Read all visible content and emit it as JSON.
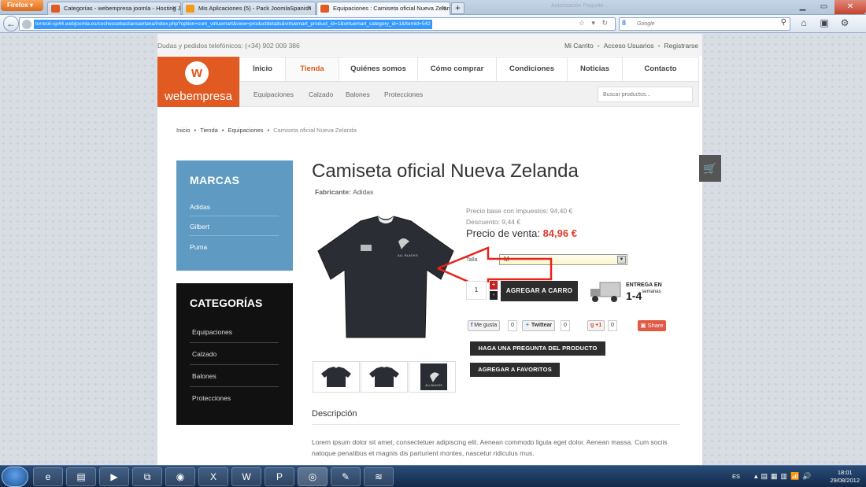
{
  "browser": {
    "menu_button": "Firefox",
    "tabs": [
      {
        "label": "Categorías - webempresa joomla - Hosting Jo...",
        "active": false,
        "icon_color": "#e05a22"
      },
      {
        "label": "Mis Aplicaciones (5) - Pack JoomlaSpanish",
        "active": false,
        "icon_color": "#f29b1a"
      },
      {
        "label": "Equipaciones : Camiseta oficial Nueva Zelanda",
        "active": true,
        "icon_color": "#e05a22"
      }
    ],
    "new_tab": "+",
    "blurred_tab": "Autorización Paquete...",
    "url": "torreoli-cp44.webjoomla.es/cochessebastiansantana/index.php?option=com_virtuemart&view=productdetails&virtuemart_product_id=1&virtuemart_category_id=1&Itemid=542",
    "search_placeholder": "Google",
    "search_engine": "8"
  },
  "site": {
    "phone": "Dudas y pedidos telefónicos: (+34) 902 009 386",
    "top_links": [
      "Mi Carrito",
      "Acceso Usuarios",
      "Registrarse"
    ],
    "logo_text": "webempresa",
    "logo_mark": "w",
    "nav": [
      {
        "label": "Inicio",
        "active": false
      },
      {
        "label": "Tienda",
        "active": true
      },
      {
        "label": "Quiénes somos",
        "active": false
      },
      {
        "label": "Cómo comprar",
        "active": false
      },
      {
        "label": "Condiciones",
        "active": false
      },
      {
        "label": "Noticias",
        "active": false
      },
      {
        "label": "Contacto",
        "active": false
      }
    ],
    "subnav": [
      "Equipaciones",
      "Calzado",
      "Balones",
      "Protecciones"
    ],
    "product_search_placeholder": "Buscar productos...",
    "breadcrumbs": [
      "Inicio",
      "Tienda",
      "Equipaciones",
      "Camiseta oficial Nueva Zelanda"
    ],
    "brands_title": "MARCAS",
    "brands": [
      "Adidas",
      "Gilbert",
      "Puma"
    ],
    "categories_title": "CATEGORÍAS",
    "categories": [
      "Equipaciones",
      "Calzado",
      "Balones",
      "Protecciones"
    ],
    "accent_color": "#e05a22",
    "brands_bg": "#5e9ac2"
  },
  "product": {
    "title": "Camiseta oficial Nueva Zelanda",
    "maker_label": "Fabricante:",
    "maker": "Adidas",
    "price_base": "Precio base con impuestos: 94,40 €",
    "discount": "Descuento: 9,44 €",
    "sale_label": "Precio de venta:",
    "sale_price": "84,96 €",
    "size_label": "Talla",
    "size_value": "M",
    "quantity": "1",
    "qty_plus": "+",
    "qty_minus": "-",
    "add_to_cart": "AGREGAR A CARRO",
    "delivery_label": "ENTREGA EN",
    "delivery_value": "1-4",
    "delivery_unit": "semanas",
    "social": {
      "fb_label": "Me gusta",
      "fb_count": "0",
      "tw_label": "Twittear",
      "tw_count": "0",
      "gplus_label": "+1",
      "gplus_count": "0",
      "share_label": "Share"
    },
    "ask_question": "HAGA UNA PREGUNTA DEL PRODUCTO",
    "add_favorites": "AGREGAR A FAVORITOS",
    "shirt_logo_text": "ALL BLACKS",
    "description_title": "Descripción",
    "description": "Lorem ipsum dolor sit amet, consectetuer adipiscing elit. Aenean commodo ligula eget dolor. Aenean massa. Cum sociis natoque penatibus et magnis dis parturient montes, nascetur ridiculus mus."
  },
  "taskbar": {
    "language": "ES",
    "time": "18:01",
    "date": "29/08/2012"
  }
}
